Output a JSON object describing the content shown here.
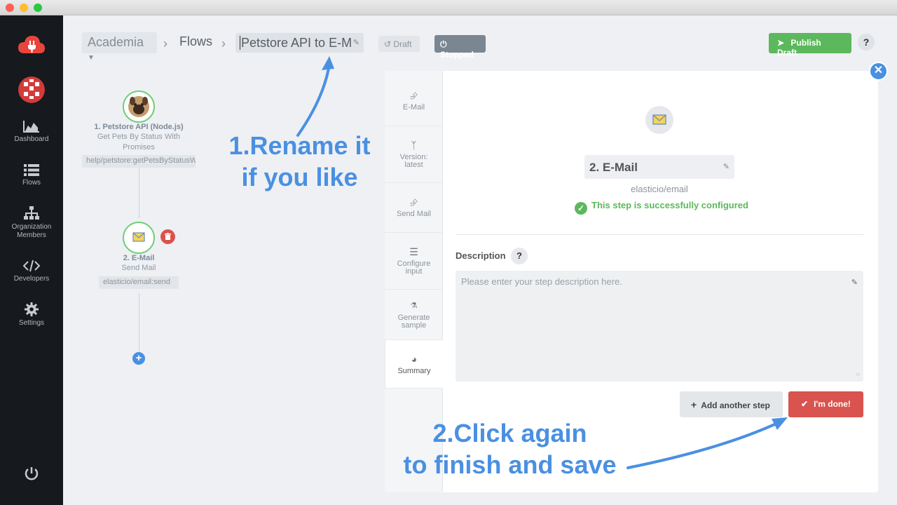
{
  "window": {
    "close_color": "#fe5f57",
    "min_color": "#febc2e",
    "max_color": "#28c840"
  },
  "sidebar": {
    "items": [
      {
        "label": "Dashboard",
        "icon": "area-chart-icon"
      },
      {
        "label": "Flows",
        "icon": "list-icon"
      },
      {
        "label": "Organization Members",
        "icon": "sitemap-icon"
      },
      {
        "label": "Developers",
        "icon": "code-icon"
      },
      {
        "label": "Settings",
        "icon": "gear-icon"
      }
    ]
  },
  "header": {
    "workspace": "Academia",
    "flows": "Flows",
    "flow_name": "Petstore API to E-M",
    "draft_label": "Draft",
    "stopped_label": "Stopped",
    "publish_label": "Publish Draft",
    "help": "?"
  },
  "canvas": {
    "step1": {
      "title": "1. Petstore API (Node.js)",
      "subtitle": "Get Pets By Status With Promises",
      "code": "help/petstore:getPetsByStatusW"
    },
    "step2": {
      "title": "2. E-Mail",
      "subtitle": "Send Mail",
      "code": "elasticio/email:send"
    }
  },
  "panel": {
    "tabs": [
      {
        "label": "E-Mail"
      },
      {
        "label": "Version: latest"
      },
      {
        "label": "Send Mail"
      },
      {
        "label": "Configure input"
      },
      {
        "label": "Generate sample"
      },
      {
        "label": "Summary"
      }
    ],
    "step_name": "2. E-Mail",
    "component": "elasticio/email",
    "status": "This step is successfully configured",
    "description_label": "Description",
    "description_help": "?",
    "description_placeholder": "Please enter your step description here.",
    "add_step_label": "Add another step",
    "done_label": "I'm done!"
  },
  "annotations": {
    "rename_line1": "1.Rename it",
    "rename_line2": "if you like",
    "finish_line1": "2.Click again",
    "finish_line2": "to finish and save"
  },
  "colors": {
    "accent": "#4a90e2",
    "success": "#5cb85c",
    "danger": "#d9534f",
    "sidebar": "#16191d"
  }
}
